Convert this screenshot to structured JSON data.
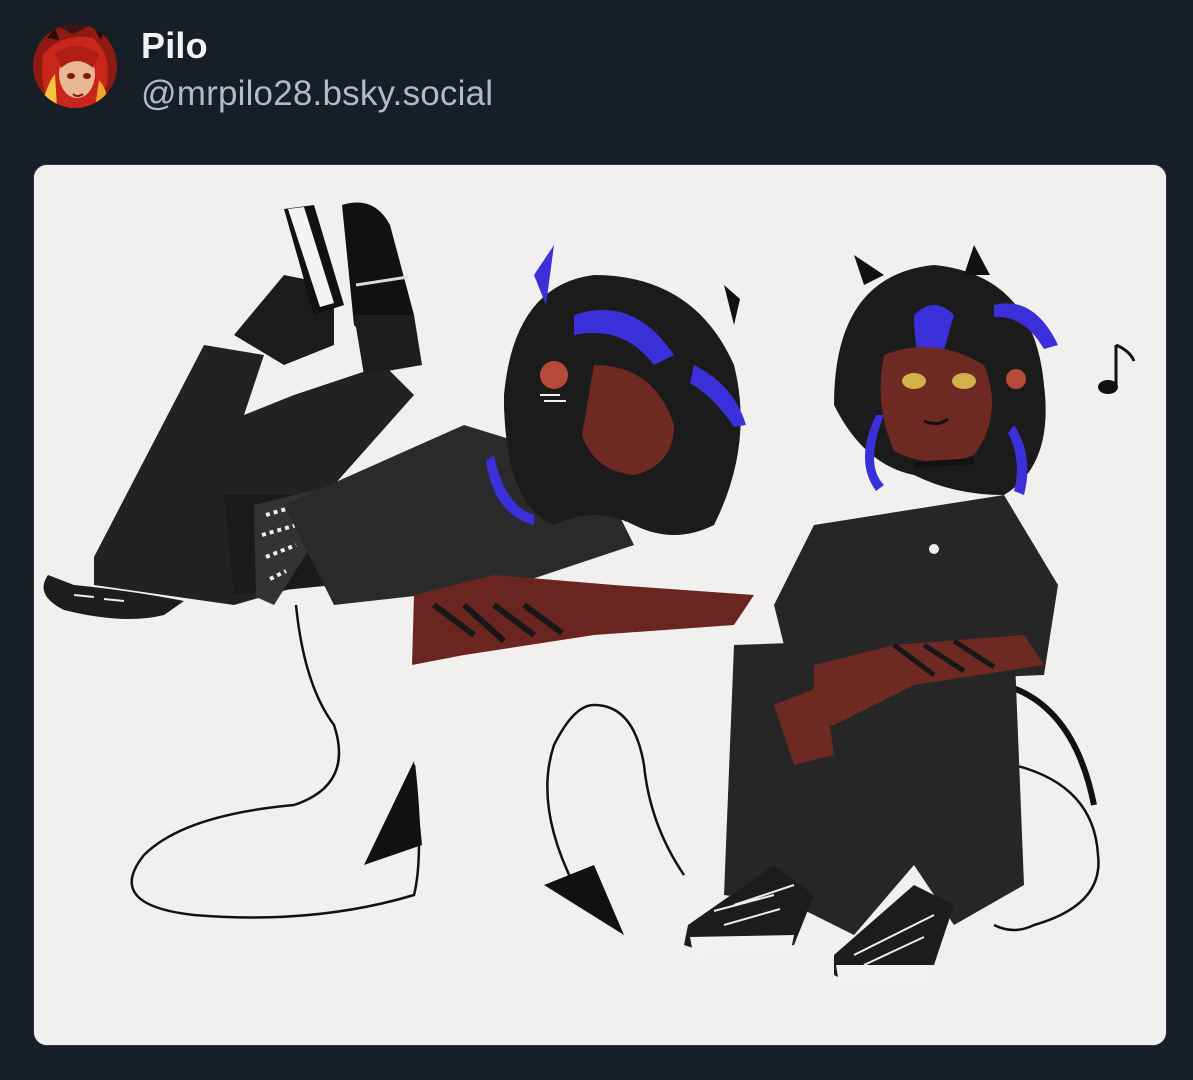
{
  "post": {
    "author": {
      "display_name": "Pilo",
      "handle": "@mrpilo28.bsky.social",
      "avatar_icon": "avatar-image"
    },
    "media": {
      "type": "image",
      "icon": "artwork-image"
    }
  },
  "colors": {
    "background": "#161e27",
    "name_text": "#f1f3f5",
    "handle_text": "#aebbc9",
    "paper": "#f1f0ee",
    "accent_hair": "#3b2fd9",
    "skin": "#6e2a22"
  }
}
